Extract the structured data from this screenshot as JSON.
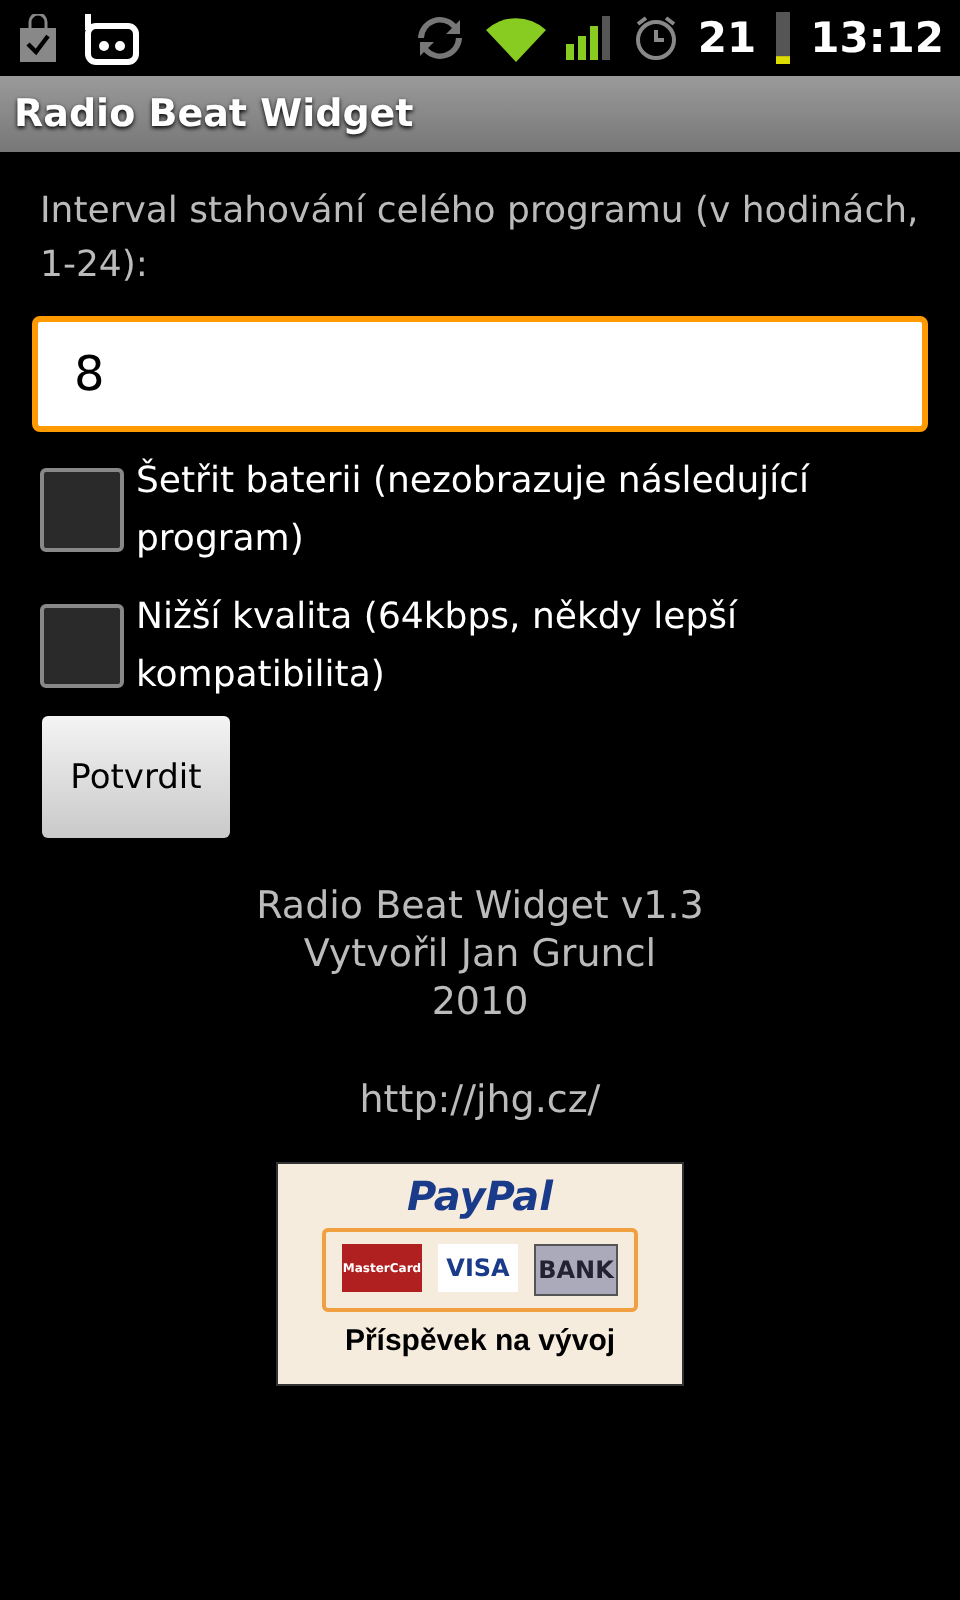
{
  "status_bar": {
    "battery": "21",
    "battery_meter": {
      "level": 0.15
    },
    "time": "13:12"
  },
  "title_bar": {
    "title": "Radio Beat Widget"
  },
  "interval": {
    "label": "Interval stahování celého programu (v hodinách, 1-24):",
    "value": "8"
  },
  "options": [
    {
      "label": "Šetřit baterii (nezobrazuje následující program)",
      "checked": false
    },
    {
      "label": "Nižší kvalita (64kbps, někdy lepší kompatibilita)",
      "checked": false
    }
  ],
  "confirm_button": "Potvrdit",
  "about": [
    "Radio Beat Widget v1.3",
    "Vytvořil Jan Gruncl",
    "2010"
  ],
  "link": "http://jhg.cz/",
  "donate": {
    "brand": "PayPal",
    "cards": [
      "MasterCard",
      "VISA",
      "BANK"
    ],
    "caption": "Příspěvek na vývoj"
  }
}
